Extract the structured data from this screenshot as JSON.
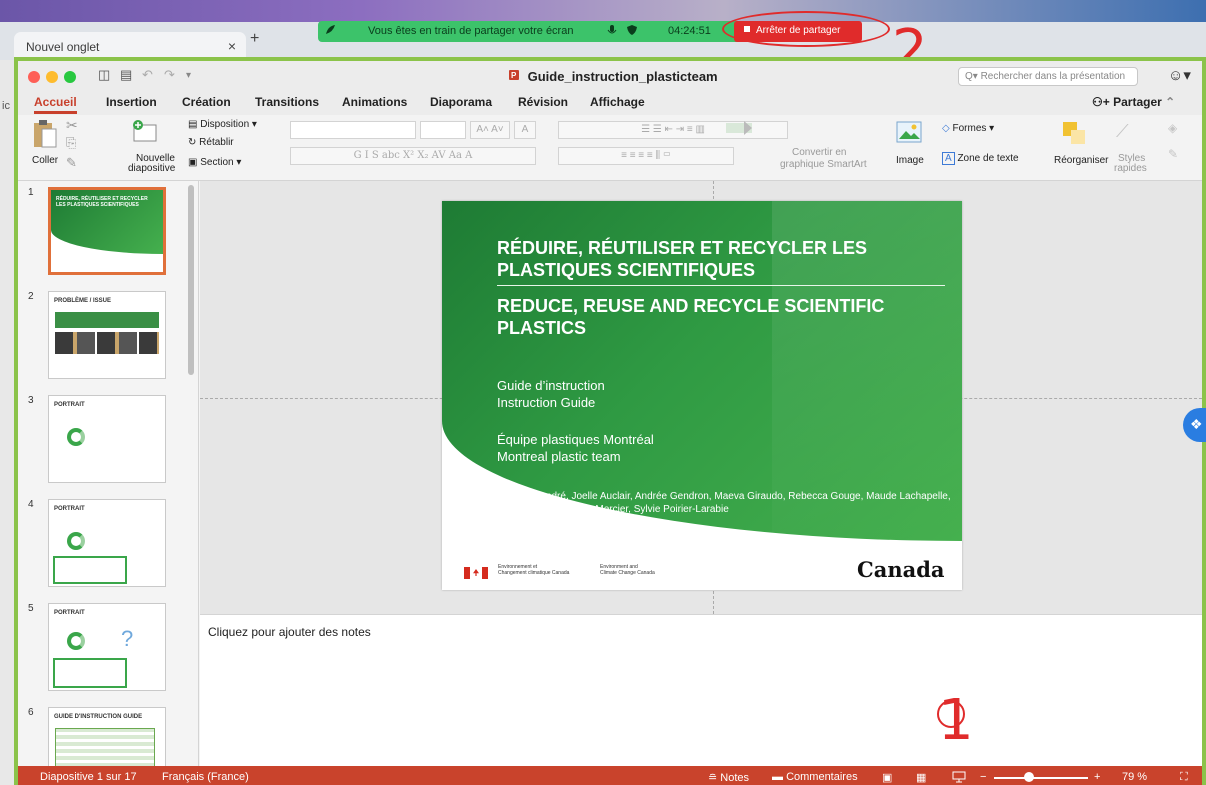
{
  "browser": {
    "tab_label": "Nouvel onglet",
    "tab_close": "×",
    "new_tab": "+",
    "left_edge_text": "ic"
  },
  "share": {
    "message": "Vous êtes en train de partager votre écran",
    "timer": "04:24:51",
    "stop_label": "Arrêter de partager"
  },
  "annotations": {
    "label_2": "2",
    "label_1": "1"
  },
  "window": {
    "title": "Guide_instruction_plasticteam",
    "search_placeholder": "Rechercher dans la présentation"
  },
  "ribbon_tabs": [
    "Accueil",
    "Insertion",
    "Création",
    "Transitions",
    "Animations",
    "Diaporama",
    "Révision",
    "Affichage"
  ],
  "share_button": "Partager",
  "ribbon": {
    "paste": "Coller",
    "new_slide_1": "Nouvelle",
    "new_slide_2": "diapositive",
    "layout": "Disposition",
    "reset": "Rétablir",
    "section": "Section",
    "convert_1": "Convertir en",
    "convert_2": "graphique SmartArt",
    "image": "Image",
    "shapes": "Formes",
    "textbox": "Zone de texte",
    "arrange": "Réorganiser",
    "styles_1": "Styles",
    "styles_2": "rapides"
  },
  "thumbnails": [
    {
      "num": "1",
      "title": "RÉDUIRE, RÉUTILISER ET RECYCLER LES PLASTIQUES SCIENTIFIQUES"
    },
    {
      "num": "2",
      "title": "PROBLÈME / ISSUE"
    },
    {
      "num": "3",
      "title": "PORTRAIT"
    },
    {
      "num": "4",
      "title": "PORTRAIT"
    },
    {
      "num": "5",
      "title": "PORTRAIT"
    },
    {
      "num": "6",
      "title": "GUIDE D'INSTRUCTION GUIDE"
    }
  ],
  "slide": {
    "title_fr": "RÉDUIRE, RÉUTILISER ET RECYCLER LES PLASTIQUES SCIENTIFIQUES",
    "title_en": "REDUCE, REUSE AND RECYCLE SCIENTIFIC PLASTICS",
    "guide_fr": "Guide d’instruction",
    "guide_en": "Instruction Guide",
    "team_fr": "Équipe plastiques Montréal",
    "team_en": "Montreal plastic team",
    "authors": "Chantale André, Joelle Auclair, Andrée Gendron, Maeva Giraudo, Rebecca Gouge, Maude Lachapelle, Émilie Lacaze, Laurie Mercier, Sylvie Poirier-Larabie",
    "dept_fr_1": "Environnement et",
    "dept_fr_2": "Changement climatique Canada",
    "dept_en_1": "Environment and",
    "dept_en_2": "Climate Change Canada",
    "wordmark": "Canada"
  },
  "notes_placeholder": "Cliquez pour ajouter des notes",
  "status": {
    "slide_count": "Diapositive 1 sur 17",
    "language": "Français (France)",
    "notes": "Notes",
    "comments": "Commentaires",
    "zoom_minus": "−",
    "zoom_plus": "+",
    "zoom": "79 %"
  },
  "colors": {
    "ppt_accent": "#c8402c",
    "frame_highlight": "#8bc34a",
    "annotation_red": "#e02b2b",
    "share_green": "#3cc36a",
    "slide_green": "#2f9a43"
  }
}
